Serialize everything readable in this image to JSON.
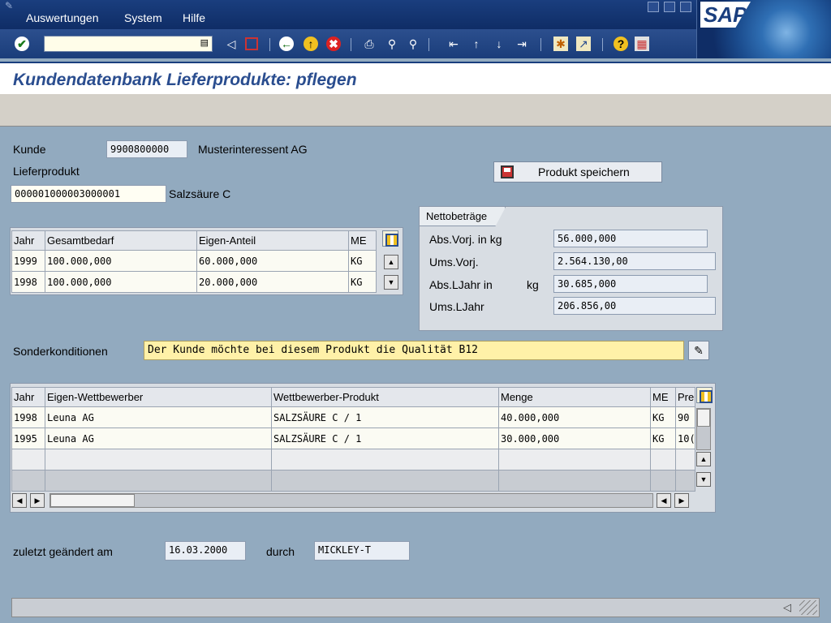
{
  "menu": {
    "items": [
      {
        "label": "Auswertungen"
      },
      {
        "label": "System"
      },
      {
        "label": "Hilfe"
      }
    ]
  },
  "logo": {
    "text": "SAP"
  },
  "toolbar": {
    "icons": [
      "enter-icon",
      "back-icon",
      "save-icon",
      "back-green-icon",
      "exit-icon",
      "cancel-icon",
      "print-icon",
      "find-icon",
      "find-next-icon",
      "first-page-icon",
      "previous-page-icon",
      "next-page-icon",
      "last-page-icon",
      "create-session-icon",
      "shortcut-icon",
      "help-icon",
      "layout-icon"
    ]
  },
  "title": "Kundendatenbank Lieferprodukte: pflegen",
  "customer": {
    "label": "Kunde",
    "number": "9900800000",
    "name": "Musterinteressent AG"
  },
  "product": {
    "label": "Lieferprodukt",
    "number": "000001000003000001",
    "name": "Salzsäure C"
  },
  "save_button": {
    "label": "Produkt speichern"
  },
  "netto": {
    "title": "Nettobeträge",
    "rows": [
      {
        "label": "Abs.Vorj. in kg",
        "value": "56.000,000"
      },
      {
        "label": "Ums.Vorj.",
        "value": "2.564.130,00"
      },
      {
        "label": "Abs.LJahr in",
        "unit": "kg",
        "value": "30.685,000"
      },
      {
        "label": "Ums.LJahr",
        "value": "206.856,00"
      }
    ]
  },
  "demand_table": {
    "headers": [
      "Jahr",
      "Gesamtbedarf",
      "Eigen-Anteil",
      "ME"
    ],
    "rows": [
      [
        "1999",
        "100.000,000",
        "60.000,000",
        "KG"
      ],
      [
        "1998",
        "100.000,000",
        "20.000,000",
        "KG"
      ]
    ]
  },
  "special": {
    "label": "Sonderkonditionen",
    "value": "Der Kunde möchte bei diesem Produkt die Qualität B12"
  },
  "competitor_table": {
    "headers": [
      "Jahr",
      "Eigen-Wettbewerber",
      "Wettbewerber-Produkt",
      "Menge",
      "ME",
      "Pre"
    ],
    "rows": [
      [
        "1998",
        "Leuna AG",
        "SALZSÄURE C / 1",
        "40.000,000",
        "KG",
        "90"
      ],
      [
        "1995",
        "Leuna AG",
        "SALZSÄURE C / 1",
        "30.000,000",
        "KG",
        "10("
      ],
      [
        "",
        "",
        "",
        "",
        "",
        ""
      ],
      [
        "",
        "",
        "",
        "",
        "",
        ""
      ]
    ]
  },
  "changed": {
    "label": "zuletzt geändert am",
    "date": "16.03.2000",
    "by_label": "durch",
    "user": "MICKLEY-T"
  }
}
